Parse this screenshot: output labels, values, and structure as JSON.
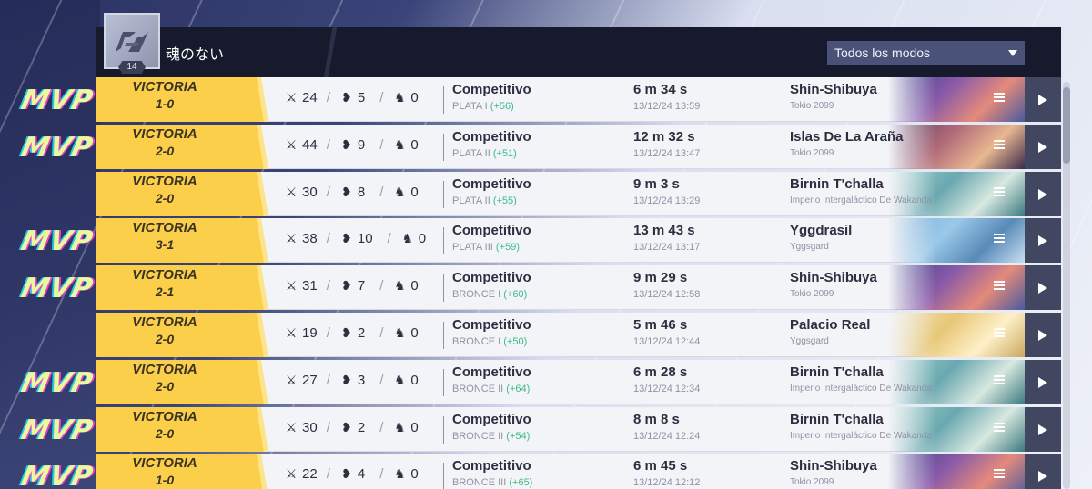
{
  "header": {
    "player_name": "魂のない",
    "level": "14",
    "mode_filter": "Todos los modos",
    "colors": {
      "header_bg": "#161a2c",
      "select_bg": "#4b5279"
    }
  },
  "mvp_label": "MVP",
  "stat_icons": {
    "kills": "crossed-swords-icon",
    "deaths": "broken-heart-icon",
    "assists": "assist-icon"
  },
  "colors": {
    "win": "#fbcf4a",
    "rank_gain": "#3dbb85",
    "play_bg": "#424761"
  },
  "matches": [
    {
      "mvp": true,
      "result": "VICTORIA",
      "score": "1-0",
      "kills": "24",
      "deaths": "5",
      "assists": "0",
      "mode": "Competitivo",
      "rank": "PLATA I",
      "delta": "(+56)",
      "duration": "6 m 34 s",
      "date": "13/12/24 13:59",
      "map": "Shin-Shibuya",
      "region": "Tokio 2099"
    },
    {
      "mvp": true,
      "result": "VICTORIA",
      "score": "2-0",
      "kills": "44",
      "deaths": "9",
      "assists": "0",
      "mode": "Competitivo",
      "rank": "PLATA II",
      "delta": "(+51)",
      "duration": "12 m 32 s",
      "date": "13/12/24 13:47",
      "map": "Islas De La Araña",
      "region": "Tokio 2099"
    },
    {
      "mvp": false,
      "result": "VICTORIA",
      "score": "2-0",
      "kills": "30",
      "deaths": "8",
      "assists": "0",
      "mode": "Competitivo",
      "rank": "PLATA II",
      "delta": "(+55)",
      "duration": "9 m 3 s",
      "date": "13/12/24 13:29",
      "map": "Birnin T'challa",
      "region": "Imperio Intergaláctico De Wakanda"
    },
    {
      "mvp": true,
      "result": "VICTORIA",
      "score": "3-1",
      "kills": "38",
      "deaths": "10",
      "assists": "0",
      "mode": "Competitivo",
      "rank": "PLATA III",
      "delta": "(+59)",
      "duration": "13 m 43 s",
      "date": "13/12/24 13:17",
      "map": "Yggdrasil",
      "region": "Yggsgard"
    },
    {
      "mvp": true,
      "result": "VICTORIA",
      "score": "2-1",
      "kills": "31",
      "deaths": "7",
      "assists": "0",
      "mode": "Competitivo",
      "rank": "BRONCE I",
      "delta": "(+60)",
      "duration": "9 m 29 s",
      "date": "13/12/24 12:58",
      "map": "Shin-Shibuya",
      "region": "Tokio 2099"
    },
    {
      "mvp": false,
      "result": "VICTORIA",
      "score": "2-0",
      "kills": "19",
      "deaths": "2",
      "assists": "0",
      "mode": "Competitivo",
      "rank": "BRONCE I",
      "delta": "(+50)",
      "duration": "5 m 46 s",
      "date": "13/12/24 12:44",
      "map": "Palacio Real",
      "region": "Yggsgard"
    },
    {
      "mvp": true,
      "result": "VICTORIA",
      "score": "2-0",
      "kills": "27",
      "deaths": "3",
      "assists": "0",
      "mode": "Competitivo",
      "rank": "BRONCE II",
      "delta": "(+64)",
      "duration": "6 m 28 s",
      "date": "13/12/24 12:34",
      "map": "Birnin T'challa",
      "region": "Imperio Intergaláctico De Wakanda"
    },
    {
      "mvp": true,
      "result": "VICTORIA",
      "score": "2-0",
      "kills": "30",
      "deaths": "2",
      "assists": "0",
      "mode": "Competitivo",
      "rank": "BRONCE II",
      "delta": "(+54)",
      "duration": "8 m 8 s",
      "date": "13/12/24 12:24",
      "map": "Birnin T'challa",
      "region": "Imperio Intergaláctico De Wakanda"
    },
    {
      "mvp": true,
      "result": "VICTORIA",
      "score": "1-0",
      "kills": "22",
      "deaths": "4",
      "assists": "0",
      "mode": "Competitivo",
      "rank": "BRONCE III",
      "delta": "(+65)",
      "duration": "6 m 45 s",
      "date": "13/12/24 12:12",
      "map": "Shin-Shibuya",
      "region": "Tokio 2099"
    }
  ]
}
